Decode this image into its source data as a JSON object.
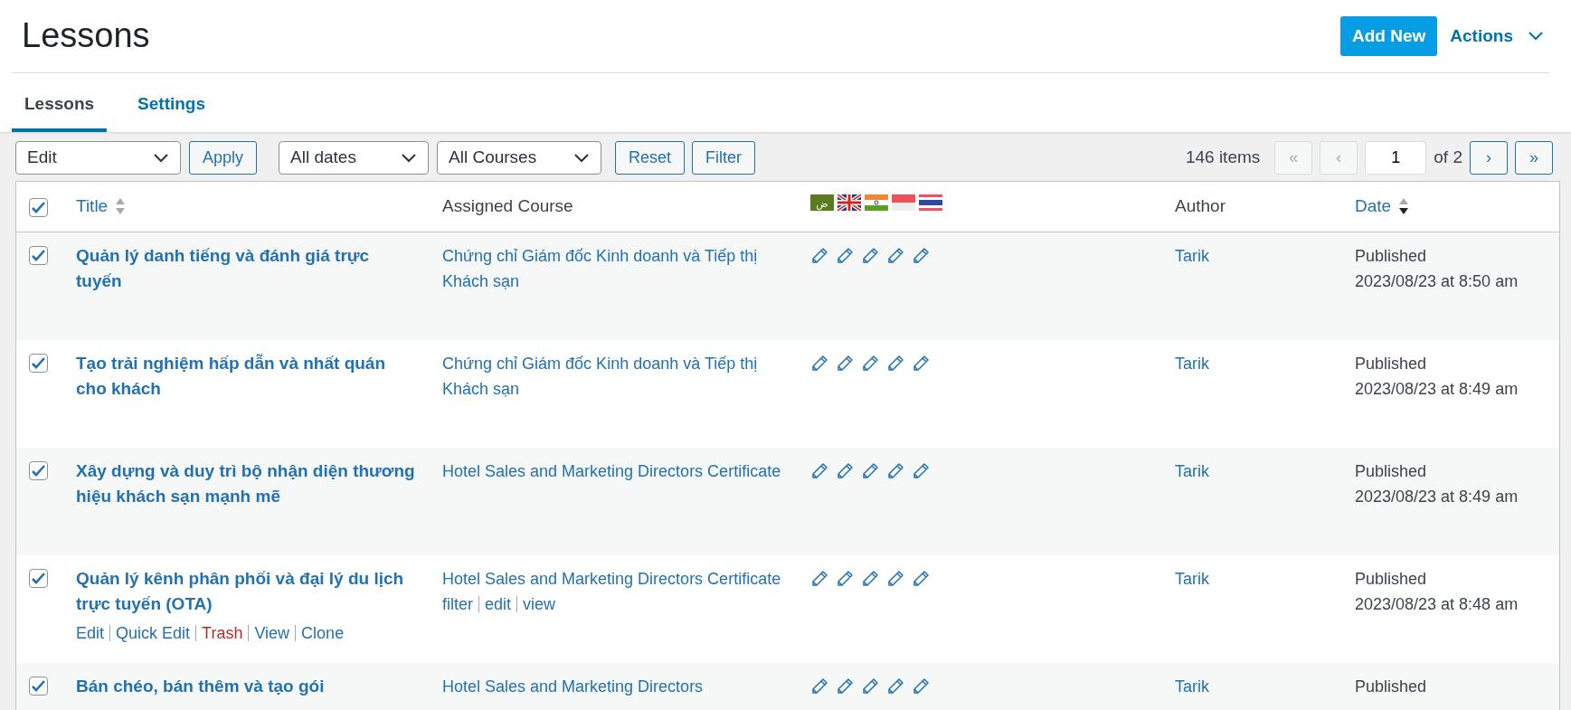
{
  "header": {
    "title": "Lessons",
    "add_button": "Add New",
    "actions_label": "Actions"
  },
  "tabs": [
    {
      "label": "Lessons",
      "selected": true
    },
    {
      "label": "Settings",
      "selected": false
    }
  ],
  "toolbar": {
    "bulk_action": "Edit",
    "apply": "Apply",
    "date_filter": "All dates",
    "course_filter": "All Courses",
    "reset": "Reset",
    "filter": "Filter",
    "items_count": "146 items",
    "pagination": [
      {
        "label": "«",
        "disabled": true
      },
      {
        "label": "‹",
        "disabled": true
      }
    ],
    "page": "1",
    "page_total": "of 2",
    "pagination_next": [
      {
        "label": "›",
        "disabled": false
      },
      {
        "label": "»",
        "disabled": false
      }
    ]
  },
  "table": {
    "select_all_checked": true,
    "columns": {
      "title": "Title",
      "course": "Assigned Course",
      "author": "Author",
      "date": "Date"
    },
    "flags": [
      {
        "kind": "arabic",
        "label": "ض"
      },
      {
        "kind": "uk"
      },
      {
        "kind": "india"
      },
      {
        "kind": "redwhite"
      },
      {
        "kind": "thai"
      }
    ],
    "rows": [
      {
        "checked": true,
        "title": "Quản lý danh tiếng và đánh giá trực tuyến",
        "course": "Chứng chỉ Giám đốc Kinh doanh và Tiếp thị Khách sạn",
        "author": "Tarik",
        "status": "Published",
        "date": "2023/08/23 at 8:50 am"
      },
      {
        "checked": true,
        "title": "Tạo trải nghiệm hấp dẫn và nhất quán cho khách",
        "course": "Chứng chỉ Giám đốc Kinh doanh và Tiếp thị Khách sạn",
        "author": "Tarik",
        "status": "Published",
        "date": "2023/08/23 at 8:49 am"
      },
      {
        "checked": true,
        "title": "Xây dựng và duy trì bộ nhận diện thương hiệu khách sạn mạnh mẽ",
        "course": "Hotel Sales and Marketing Directors Certificate",
        "author": "Tarik",
        "status": "Published",
        "date": "2023/08/23 at 8:49 am"
      },
      {
        "checked": true,
        "title": "Quản lý kênh phân phối và đại lý du lịch trực tuyến (OTA)",
        "course": "Hotel Sales and Marketing Directors Certificate",
        "author": "Tarik",
        "status": "Published",
        "date": "2023/08/23 at 8:48 am",
        "row_actions": [
          {
            "label": "Edit",
            "kind": "normal"
          },
          {
            "label": "Quick Edit",
            "kind": "normal"
          },
          {
            "label": "Trash",
            "kind": "danger"
          },
          {
            "label": "View",
            "kind": "normal"
          },
          {
            "label": "Clone",
            "kind": "normal"
          }
        ],
        "course_actions": [
          "filter",
          "edit",
          "view"
        ]
      },
      {
        "checked": true,
        "title": "Bán chéo, bán thêm và tạo gói",
        "course": "Hotel Sales and Marketing Directors",
        "author": "Tarik",
        "status": "Published"
      }
    ]
  }
}
